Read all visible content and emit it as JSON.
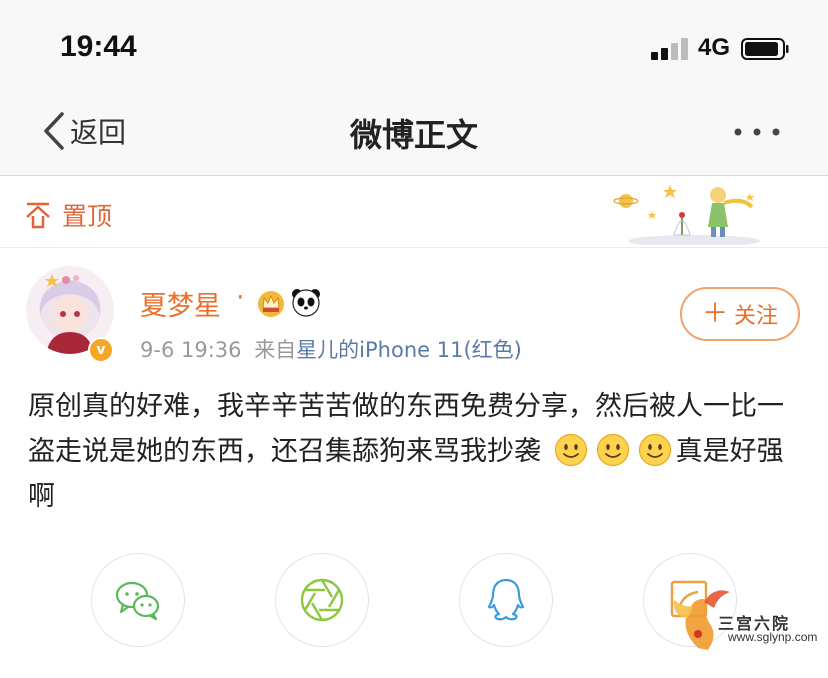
{
  "status_bar": {
    "time": "19:44",
    "network": "4G"
  },
  "nav": {
    "back_label": "返回",
    "title": "微博正文",
    "more_label": "•••"
  },
  "pin": {
    "label": "置顶"
  },
  "post": {
    "username": "夏梦星",
    "separator": "·",
    "timestamp": "9-6 19:36",
    "source_prefix": "来自",
    "source_device": "星儿的iPhone 11(红色)",
    "follow_label": "关注",
    "verified_badge": "v",
    "text_main": "原创真的好难，我辛辛苦苦做的东西免费分享，然后被人一比一盗走说是她的东西，还召集舔狗来骂我抄袭",
    "text_tail": "真是好强啊",
    "emoji_count": 3
  },
  "share": {
    "items": [
      {
        "icon": "wechat-icon"
      },
      {
        "icon": "moments-icon"
      },
      {
        "icon": "qq-icon"
      },
      {
        "icon": "weibo-share-icon"
      }
    ]
  },
  "watermark": {
    "line1": "三宫六院",
    "line2": "www.sglynp.com"
  },
  "colors": {
    "accent": "#e8702a",
    "link": "#5a7ba6",
    "wechat": "#5cb85c",
    "qq": "#3b9bdc"
  }
}
